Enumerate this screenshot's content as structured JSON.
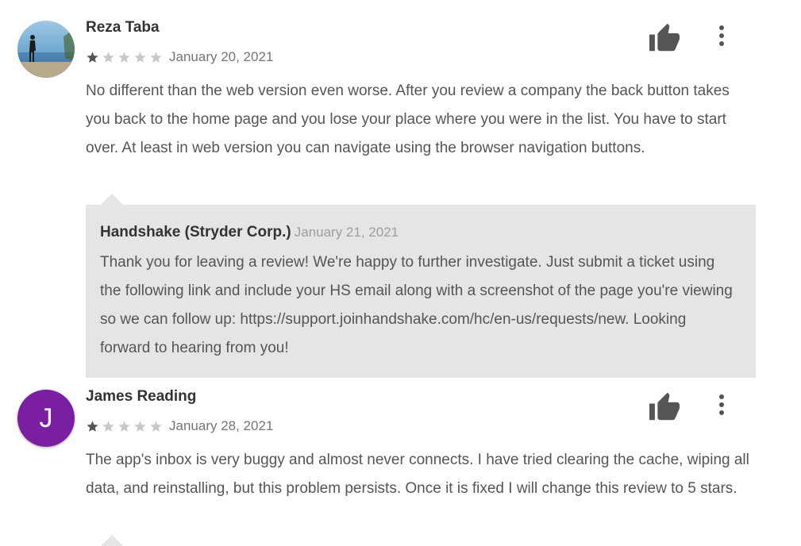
{
  "reviews": [
    {
      "author": "Reza Taba",
      "avatar": "photo-silhouette-lake",
      "rating": 1,
      "max_rating": 5,
      "date": "January 20, 2021",
      "text": "No different than the web version even worse. After you review a company the back button takes you back to the home page and you lose your place where you were in the list. You have to start over. At least in web version you can navigate using the browser navigation buttons.",
      "reply": {
        "author": "Handshake (Stryder Corp.)",
        "date": "January 21, 2021",
        "text": "Thank you for leaving a review! We're happy to further investigate. Just submit a ticket using the following link and include your HS email along with a screenshot of the page you're viewing so we can follow up: https://support.joinhandshake.com/hc/en-us/requests/new. Looking forward to hearing from you!"
      }
    },
    {
      "author": "James Reading",
      "avatar_letter": "J",
      "avatar_color": "#7b1fa2",
      "rating": 1,
      "max_rating": 5,
      "date": "January 28, 2021",
      "text": "The app's inbox is very buggy and almost never connects. I have tried clearing the cache, wiping all data, and reinstalling, but this problem persists. Once it is fixed I will change this review to 5 stars."
    }
  ],
  "icons": {
    "helpful": "thumbs-up-icon",
    "more": "more-vert-icon",
    "star": "star-icon"
  },
  "colors": {
    "star_filled": "#555555",
    "star_empty": "#c8c8c8",
    "reply_bg": "#e5e5e5",
    "icon": "#555555"
  }
}
